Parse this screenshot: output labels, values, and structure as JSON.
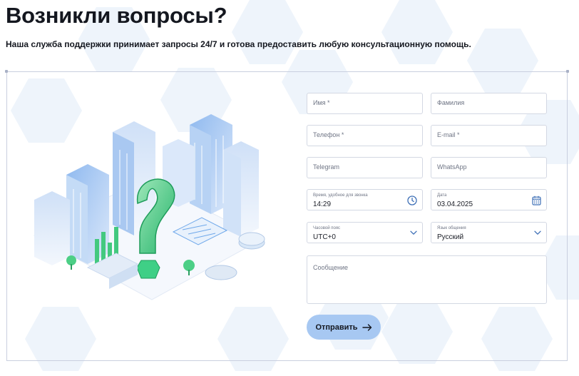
{
  "header": {
    "title": "Возникли вопросы?",
    "subtitle": "Наша служба поддержки принимает запросы 24/7 и готова предоставить любую консультационную помощь."
  },
  "form": {
    "first_name": {
      "placeholder": "Имя *"
    },
    "last_name": {
      "placeholder": "Фамилия"
    },
    "phone": {
      "placeholder": "Телефон *"
    },
    "email": {
      "placeholder": "E-mail *"
    },
    "telegram": {
      "placeholder": "Telegram"
    },
    "whatsapp": {
      "placeholder": "WhatsApp"
    },
    "call_time": {
      "label": "Время, удобное для звонка",
      "value": "14:29",
      "icon": "clock-icon"
    },
    "date": {
      "label": "Дата",
      "value": "03.04.2025",
      "icon": "calendar-icon"
    },
    "timezone": {
      "label": "Часовой пояс",
      "value": "UTC+0",
      "icon": "chevron-down-icon"
    },
    "language": {
      "label": "Язык общения",
      "value": "Русский",
      "icon": "chevron-down-icon"
    },
    "message": {
      "placeholder": "Сообщение"
    },
    "submit": {
      "label": "Отправить",
      "icon": "arrow-right-icon"
    }
  },
  "colors": {
    "accent": "#a7c8f2",
    "icon_blue": "#3d6fb6",
    "border": "#d3d8e3",
    "illustration_green": "#3fcf86",
    "illustration_blue": "#6fa8ea"
  }
}
